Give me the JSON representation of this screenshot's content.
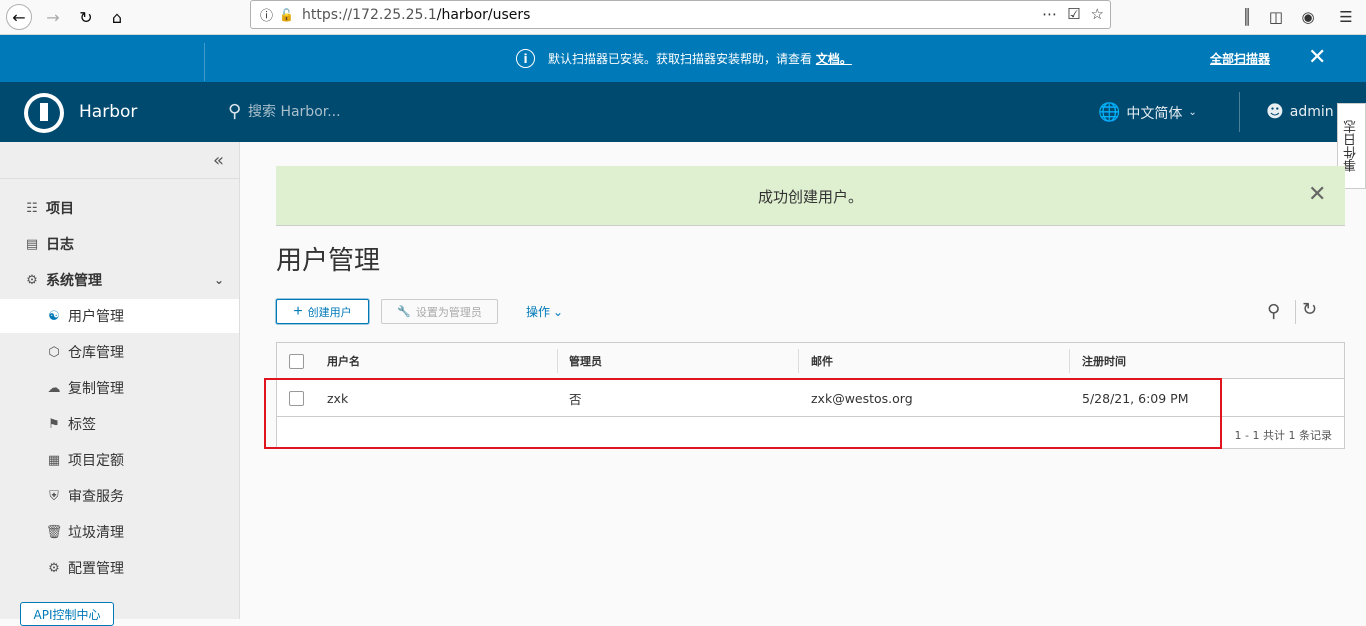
{
  "browser": {
    "url_host": "https://172.25.25.1",
    "url_path": "/harbor/users"
  },
  "banner": {
    "message": "默认扫描器已安装。获取扫描器安装帮助，请查看",
    "link": "文档。",
    "action": "全部扫描器"
  },
  "header": {
    "brand": "Harbor",
    "search_placeholder": "搜索 Harbor...",
    "language": "中文简体",
    "user": "admin",
    "event_log": "事件日志"
  },
  "sidebar": {
    "items": [
      {
        "label": "项目",
        "icon": "projects-icon"
      },
      {
        "label": "日志",
        "icon": "logs-icon"
      },
      {
        "label": "系统管理",
        "icon": "admin-icon"
      }
    ],
    "subitems": [
      {
        "label": "用户管理",
        "icon": "users-icon"
      },
      {
        "label": "仓库管理",
        "icon": "registry-icon"
      },
      {
        "label": "复制管理",
        "icon": "replication-icon"
      },
      {
        "label": "标签",
        "icon": "tag-icon"
      },
      {
        "label": "项目定额",
        "icon": "quota-icon"
      },
      {
        "label": "审查服务",
        "icon": "shield-icon"
      },
      {
        "label": "垃圾清理",
        "icon": "trash-icon"
      },
      {
        "label": "配置管理",
        "icon": "gear-icon"
      }
    ],
    "api_button": "API控制中心"
  },
  "main": {
    "alert": "成功创建用户。",
    "title": "用户管理",
    "create_button": "创建用户",
    "set_admin_button": "设置为管理员",
    "actions_label": "操作",
    "columns": [
      "用户名",
      "管理员",
      "邮件",
      "注册时间"
    ],
    "rows": [
      {
        "username": "zxk",
        "admin": "否",
        "email": "zxk@westos.org",
        "registered": "5/28/21, 6:09 PM"
      }
    ],
    "footer": "1 - 1 共计 1 条记录"
  }
}
